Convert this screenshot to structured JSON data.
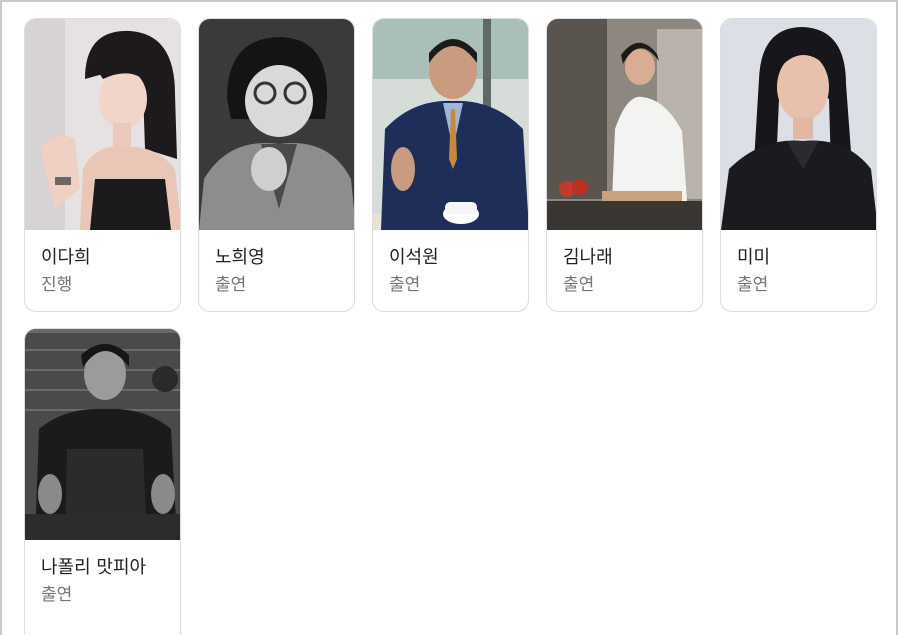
{
  "people": [
    {
      "name": "이다희",
      "role": "진행"
    },
    {
      "name": "노희영",
      "role": "출연"
    },
    {
      "name": "이석원",
      "role": "출연"
    },
    {
      "name": "김나래",
      "role": "출연"
    },
    {
      "name": "미미",
      "role": "출연"
    },
    {
      "name": "나폴리 맛피아",
      "role": "출연"
    }
  ]
}
